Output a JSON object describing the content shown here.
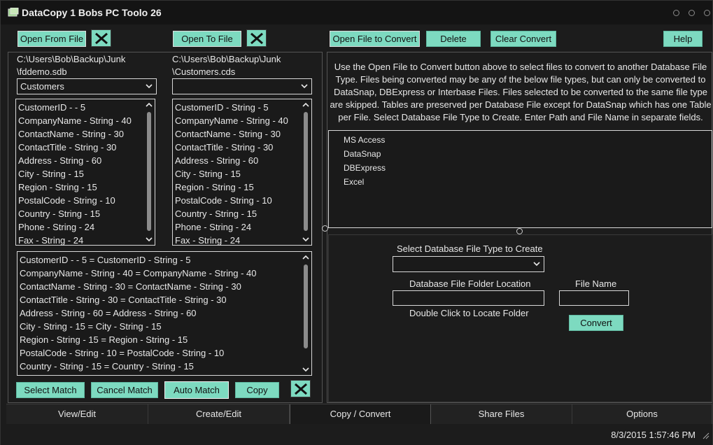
{
  "window": {
    "title": "DataCopy 1 Bobs PC Toolo 26"
  },
  "toolbar": {
    "open_from_label": "Open From File",
    "open_to_label": "Open To File",
    "open_convert_label": "Open File to Convert",
    "delete_label": "Delete",
    "clear_convert_label": "Clear Convert",
    "help_label": "Help"
  },
  "source": {
    "path_line1": "C:\\Users\\Bob\\Backup\\Junk",
    "path_line2": "\\fddemo.sdb",
    "table_selected": "Customers",
    "fields": [
      "CustomerID -  - 5",
      "CompanyName - String - 40",
      "ContactName - String - 30",
      "ContactTitle - String - 30",
      "Address - String - 60",
      "City - String - 15",
      "Region - String - 15",
      "PostalCode - String - 10",
      "Country - String - 15",
      "Phone - String - 24",
      "Fax - String - 24"
    ]
  },
  "target": {
    "path_line1": "C:\\Users\\Bob\\Backup\\Junk",
    "path_line2": "\\Customers.cds",
    "table_selected": "",
    "fields": [
      "CustomerID - String - 5",
      "CompanyName - String - 40",
      "ContactName - String - 30",
      "ContactTitle - String - 30",
      "Address - String - 60",
      "City - String - 15",
      "Region - String - 15",
      "PostalCode - String - 10",
      "Country - String - 15",
      "Phone - String - 24",
      "Fax - String - 24"
    ]
  },
  "matches": [
    "CustomerID -  - 5 = CustomerID - String - 5",
    "CompanyName - String - 40 = CompanyName - String - 40",
    "ContactName - String - 30 = ContactName - String - 30",
    "ContactTitle - String - 30 = ContactTitle - String - 30",
    "Address - String - 60 = Address - String - 60",
    "City - String - 15 = City - String - 15",
    "Region - String - 15 = Region - String - 15",
    "PostalCode - String - 10 = PostalCode - String - 10",
    "Country - String - 15 = Country - String - 15"
  ],
  "match_buttons": {
    "select_label": "Select Match",
    "cancel_label": "Cancel Match",
    "auto_label": "Auto Match",
    "copy_label": "Copy"
  },
  "convert": {
    "info": "Use the Open File to Convert button above to select files to convert to another Database File Type.  Files being converted may be any of the below file types, but can only be converted to DataSnap, DBExpress or Interbase Files. Files selected to be converted to the same file type are skipped. Tables are preserved per Database File except for DataSnap which has one Table per File. Select Database File Type to Create. Enter Path and File Name in separate fields.",
    "file_types": [
      "MS Access",
      "DataSnap",
      "DBExpress",
      "Excel"
    ],
    "select_type_label": "Select Database File Type to Create",
    "selected_type": "",
    "folder_label": "Database File Folder Location",
    "folder_value": "",
    "folder_hint": "Double Click to Locate Folder",
    "filename_label": "File Name",
    "filename_value": "",
    "convert_label": "Convert"
  },
  "tabs": [
    "View/Edit",
    "Create/Edit",
    "Copy / Convert",
    "Share Files",
    "Options"
  ],
  "active_tab": "Copy / Convert",
  "status": {
    "datetime": "8/3/2015 1:57:46 PM"
  },
  "colors": {
    "button": "#7ddac0",
    "background": "#1c1c1c",
    "text": "#e8e8e8"
  }
}
